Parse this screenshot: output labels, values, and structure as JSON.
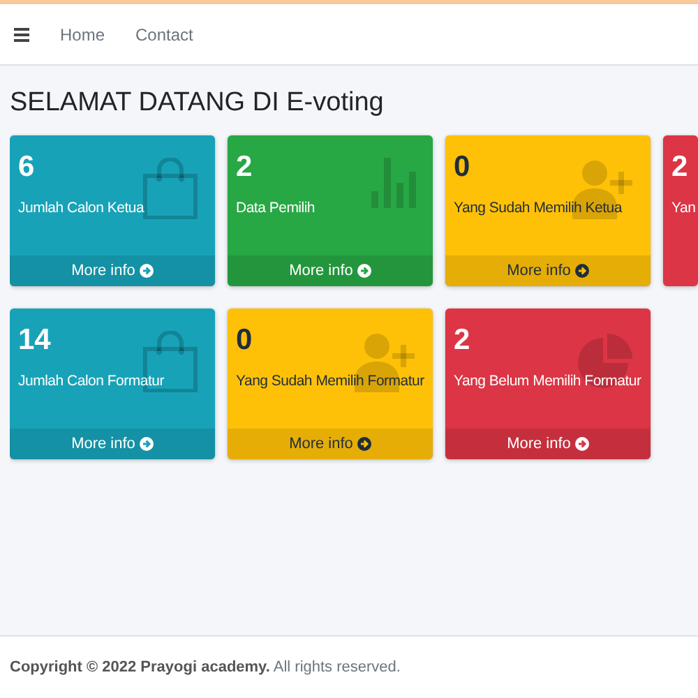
{
  "navbar": {
    "links": [
      {
        "label": "Home"
      },
      {
        "label": "Contact"
      }
    ]
  },
  "page_title": "SELAMAT DATANG DI E-voting",
  "card_rows": [
    [
      {
        "value": "6",
        "label": "Jumlah Calon Ketua",
        "color": "#17a2b8",
        "kind": "bag",
        "footer": "More info"
      },
      {
        "value": "2",
        "label": "Data Pemilih",
        "color": "#28a745",
        "kind": "bars",
        "footer": "More info"
      },
      {
        "value": "0",
        "label": "Yang Sudah Memilih Ketua",
        "color": "#ffc107",
        "kind": "person-add",
        "footer": "More info"
      },
      {
        "value": "2",
        "label": "Yan",
        "color": "#dc3545",
        "kind": "cut"
      }
    ],
    [
      {
        "value": "14",
        "label": "Jumlah Calon Formatur",
        "color": "#17a2b8",
        "kind": "bag",
        "footer": "More info"
      },
      {
        "value": "0",
        "label": "Yang Sudah Memilih Formatur",
        "color": "#ffc107",
        "kind": "person-add",
        "footer": "More info"
      },
      {
        "value": "2",
        "label": "Yang Belum Memilih Formatur",
        "color": "#dc3545",
        "kind": "pie",
        "footer": "More info"
      }
    ]
  ],
  "footer": "**Copyright © 2022 Prayogi academy.** All rights reserved."
}
